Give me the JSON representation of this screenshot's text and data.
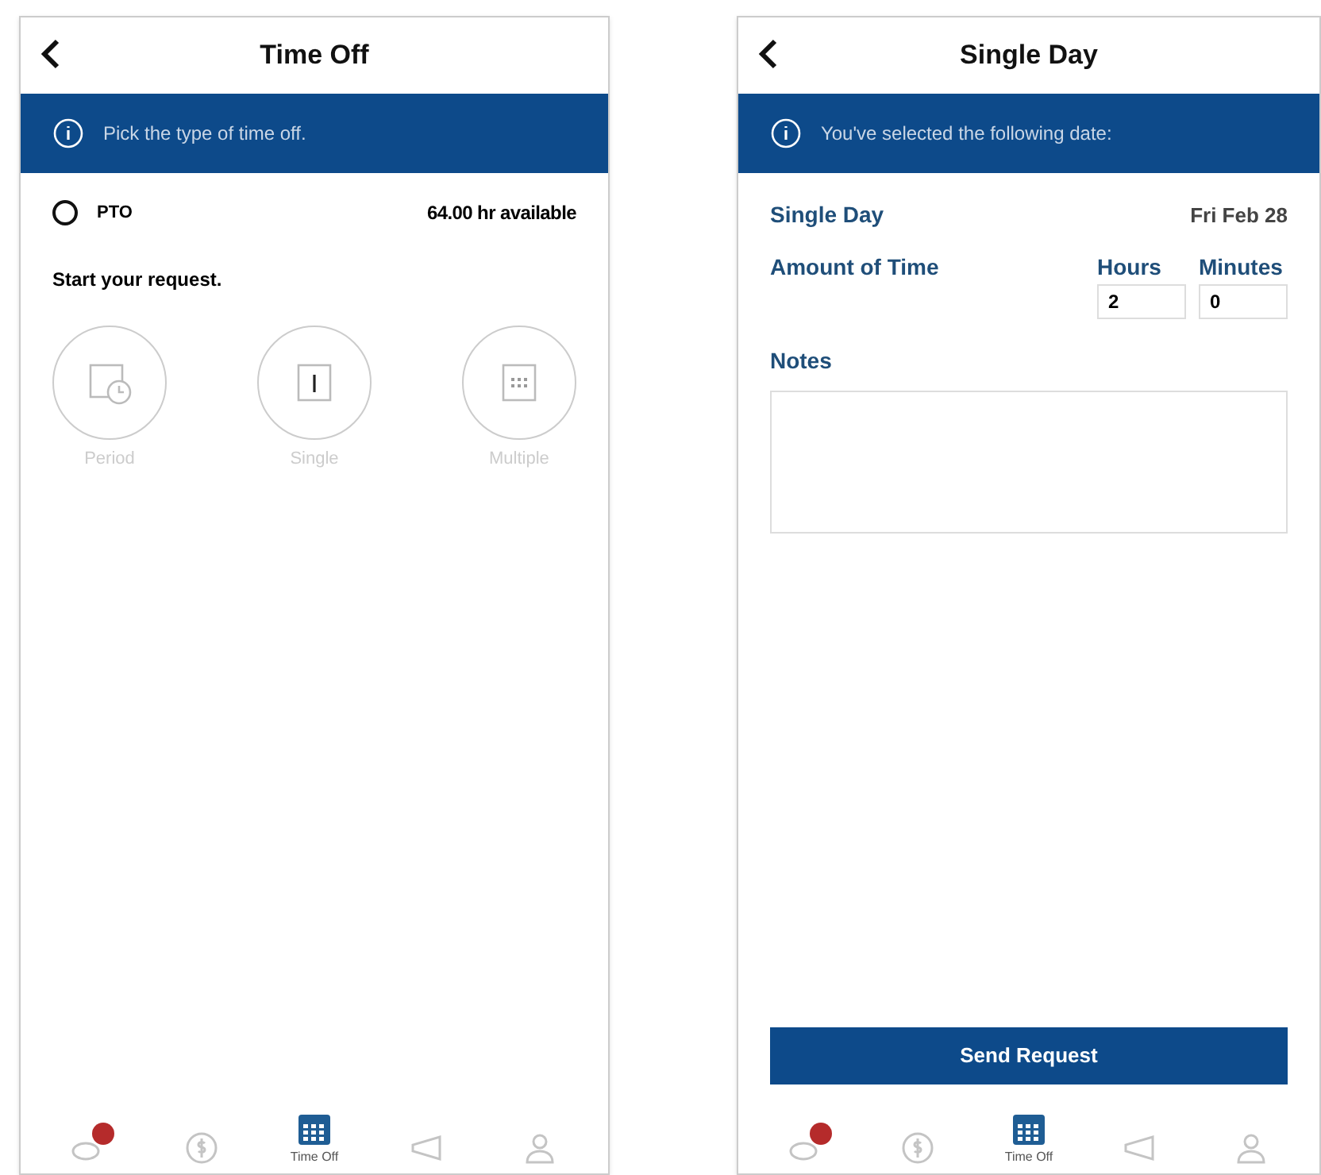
{
  "screens": [
    {
      "kind": "type_picker",
      "title": "Time Off",
      "banner": "Pick the type of time off.",
      "balance": {
        "name": "PTO",
        "checked": false,
        "available": "64.00 hr available"
      },
      "prompt": "Start your request.",
      "options": [
        {
          "kind": "range",
          "label": "Period"
        },
        {
          "kind": "single",
          "label": "Single"
        },
        {
          "kind": "multiple",
          "label": "Multiple"
        }
      ],
      "nav": [
        {
          "kind": "messages",
          "badge": true,
          "selected": false
        },
        {
          "kind": "pay",
          "badge": false,
          "selected": false
        },
        {
          "kind": "calendar",
          "label": "Time Off",
          "badge": false,
          "selected": true
        },
        {
          "kind": "megaphone",
          "badge": false,
          "selected": false
        },
        {
          "kind": "person",
          "badge": false,
          "selected": false
        }
      ]
    },
    {
      "kind": "single_day",
      "title": "Single Day",
      "banner": "You've selected the following date:",
      "day_label": "Single Day",
      "date": "Fri Feb 28",
      "amount_label": "Amount of Time",
      "hours_label": "Hours",
      "hours": "2",
      "minutes_label": "Minutes",
      "minutes": "0",
      "notes_label": "Notes",
      "submit": "Send Request",
      "nav": [
        {
          "kind": "messages",
          "badge": true,
          "selected": false
        },
        {
          "kind": "pay",
          "badge": false,
          "selected": false
        },
        {
          "kind": "calendar",
          "label": "Time Off",
          "badge": false,
          "selected": true
        },
        {
          "kind": "megaphone",
          "badge": false,
          "selected": false
        },
        {
          "kind": "person",
          "badge": false,
          "selected": false
        }
      ]
    }
  ]
}
